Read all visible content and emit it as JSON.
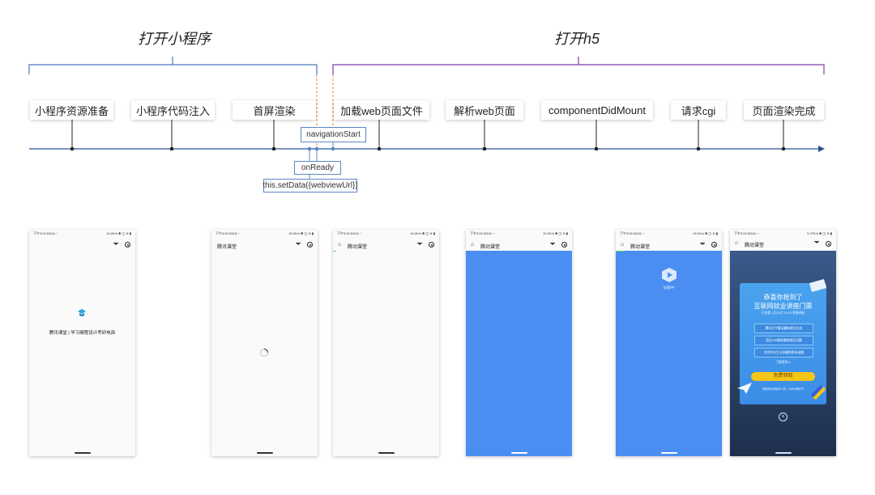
{
  "sections": [
    {
      "title": "打开小程序"
    },
    {
      "title": "打开h5"
    }
  ],
  "stages": [
    {
      "label": "小程序资源准备"
    },
    {
      "label": "小程序代码注入"
    },
    {
      "label": "首屏渲染"
    },
    {
      "label": "加载web页面文件"
    },
    {
      "label": "解析web页面"
    },
    {
      "label": "componentDidMount"
    },
    {
      "label": "请求cgi"
    },
    {
      "label": "页面渲染完成"
    }
  ],
  "events": {
    "navigation_start": "navigationStart",
    "on_ready": "onReady",
    "set_data": "this.setData({webviewUrl})"
  },
  "colors": {
    "timeline": "#4a6fa5",
    "bracket_left": "#4a78c2",
    "bracket_right": "#7a3ea8",
    "dashed": "#f08a3c",
    "phone_blue": "#4a8ef2",
    "accent_yellow": "#f5c518"
  },
  "phones": [
    {
      "status_left": "下午3:02 ◘ ◘ ◘ ···",
      "status_right": "16.0K/s ✱ ◫ ≋ ▮",
      "nav_title": "",
      "splash_text": "腾讯课堂 | 学习编程设计考研电商"
    },
    {
      "status_left": "下午3:02 ◘ ◘ ◘ ···",
      "status_right": "16.0K/s ✱ ◫ ≋ ▮",
      "nav_title": "腾讯课堂"
    },
    {
      "status_left": "下午3:02 ◘ ◘ ◘ ···",
      "status_right": "16.0K/s ✱ ◫ ≋ ▮",
      "nav_title": "腾动课堂"
    },
    {
      "status_left": "下午3:02 ◘ ◘ ◘ ···",
      "status_right": "16.0K/s ✱ ◫ ≋ ▮",
      "nav_title": "腾动课堂"
    },
    {
      "status_left": "下午3:02 ◘ ◘ ◘ ···",
      "status_right": "16.0K/s ✱ ◫ ≋ ▮",
      "nav_title": "腾动课堂",
      "loading_text": "加载中"
    },
    {
      "status_left": "下午3:02 ◘ ◘ ◘ ···",
      "status_right": "5.27K/s ✱ ◫ ≋ ▮",
      "nav_title": "腾动课堂",
      "popup": {
        "title1": "恭喜你抢到了",
        "title2": "互联网就业讲座门票",
        "subtitle": "可收看 4月28日 14:30 直播讲座",
        "options": [
          "腾讯大牛解读最新就业方向",
          "面试/HR解答最热就业问题",
          "优秀毕业生分享最热职场选题"
        ],
        "more": "了解更多 ▸",
        "button": "免费领取",
        "footnote": "获取完后添加本人码，Switch课大爷"
      }
    }
  ]
}
